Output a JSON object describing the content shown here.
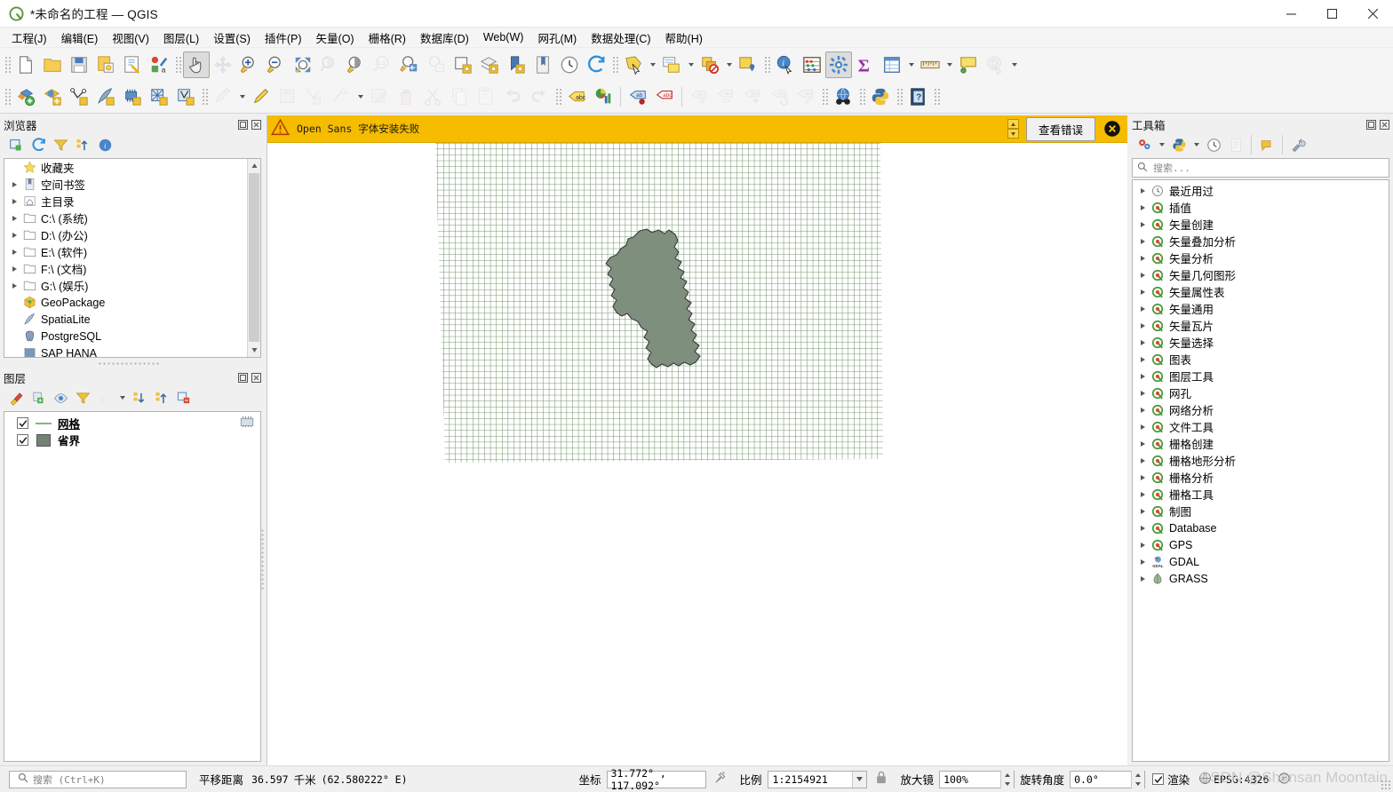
{
  "window": {
    "title": "*未命名的工程 — QGIS",
    "logo_icon": "qgis-logo-icon",
    "minimize_label": "—",
    "maximize_label": "□",
    "close_label": "✕"
  },
  "menubar": {
    "items": [
      {
        "label": "工程(J)",
        "mnemonic": "J"
      },
      {
        "label": "编辑(E)",
        "mnemonic": "E"
      },
      {
        "label": "视图(V)",
        "mnemonic": "V"
      },
      {
        "label": "图层(L)",
        "mnemonic": "L"
      },
      {
        "label": "设置(S)",
        "mnemonic": "S"
      },
      {
        "label": "插件(P)",
        "mnemonic": "P"
      },
      {
        "label": "矢量(O)",
        "mnemonic": "O"
      },
      {
        "label": "栅格(R)",
        "mnemonic": "R"
      },
      {
        "label": "数据库(D)",
        "mnemonic": "D"
      },
      {
        "label": "Web(W)",
        "mnemonic": "W"
      },
      {
        "label": "网孔(M)",
        "mnemonic": "M"
      },
      {
        "label": "数据处理(C)",
        "mnemonic": "C"
      },
      {
        "label": "帮助(H)",
        "mnemonic": "H"
      }
    ]
  },
  "toolbar_main": {
    "buttons": [
      {
        "name": "new-project-icon"
      },
      {
        "name": "open-project-icon"
      },
      {
        "name": "save-project-icon"
      },
      {
        "name": "save-project-as-icon"
      },
      {
        "name": "project-properties-icon"
      },
      {
        "name": "style-manager-icon"
      },
      {
        "name": "pan-map-icon",
        "active": true
      },
      {
        "name": "pan-to-selection-icon",
        "disabled": true
      },
      {
        "name": "zoom-in-icon"
      },
      {
        "name": "zoom-out-icon"
      },
      {
        "name": "zoom-full-icon"
      },
      {
        "name": "zoom-native-icon",
        "disabled": true
      },
      {
        "name": "zoom-to-selection-icon"
      },
      {
        "name": "zoom-1-1-icon",
        "disabled": true
      },
      {
        "name": "zoom-last-icon"
      },
      {
        "name": "zoom-next-icon",
        "disabled": true
      },
      {
        "name": "zoom-to-layer-icon"
      },
      {
        "name": "zoom-to-layers-icon"
      },
      {
        "name": "new-bookmark-icon"
      },
      {
        "name": "show-bookmarks-icon"
      },
      {
        "name": "temporal-controller-icon"
      },
      {
        "name": "refresh-icon"
      },
      {
        "name": "select-features-icon"
      },
      {
        "name": "attribute-table-icon"
      },
      {
        "name": "deselect-features-icon"
      },
      {
        "name": "select-value-icon"
      },
      {
        "name": "identify-features-icon"
      },
      {
        "name": "measure-abacus-icon"
      },
      {
        "name": "processing-toolbox-icon",
        "active": true
      },
      {
        "name": "statistical-summary-icon"
      },
      {
        "name": "open-table-icon"
      },
      {
        "name": "measure-line-icon"
      },
      {
        "name": "map-tips-icon"
      },
      {
        "name": "run-feature-action-icon",
        "disabled": true
      }
    ]
  },
  "toolbar_digitizing": {
    "buttons": [
      {
        "name": "add-layer-icon"
      },
      {
        "name": "add-wms-layer-icon"
      },
      {
        "name": "add-vector-layer-icon"
      },
      {
        "name": "add-spatialite-layer-icon"
      },
      {
        "name": "add-mesh-layer-icon"
      },
      {
        "name": "add-delimited-text-layer-icon"
      },
      {
        "name": "add-virtual-layer-icon"
      },
      {
        "name": "current-edits-icon",
        "disabled": true
      },
      {
        "name": "toggle-editing-icon"
      },
      {
        "name": "save-layer-edits-icon",
        "disabled": true
      },
      {
        "name": "add-feature-icon",
        "disabled": true
      },
      {
        "name": "vertex-tool-icon",
        "disabled": true
      },
      {
        "name": "modify-attributes-icon",
        "disabled": true
      },
      {
        "name": "delete-selected-icon",
        "disabled": true
      },
      {
        "name": "cut-features-icon",
        "disabled": true
      },
      {
        "name": "copy-features-icon",
        "disabled": true
      },
      {
        "name": "paste-features-icon",
        "disabled": true
      },
      {
        "name": "undo-icon",
        "disabled": true
      },
      {
        "name": "redo-icon",
        "disabled": true
      },
      {
        "name": "label-icon"
      },
      {
        "name": "diagram-icon"
      },
      {
        "name": "pin-labels-icon"
      },
      {
        "name": "highlight-labels-icon"
      },
      {
        "name": "move-label-icon",
        "disabled": true
      },
      {
        "name": "show-hide-labels-icon",
        "disabled": true
      },
      {
        "name": "move-label-diagram-icon",
        "disabled": true
      },
      {
        "name": "rotate-label-icon",
        "disabled": true
      },
      {
        "name": "change-label-icon",
        "disabled": true
      },
      {
        "name": "metasearch-icon"
      },
      {
        "name": "python-console-icon"
      },
      {
        "name": "help-icon"
      }
    ]
  },
  "browser_panel": {
    "title": "浏览器",
    "float_icon": "float-panel-icon",
    "close_icon": "close-panel-icon",
    "toolbar": [
      {
        "name": "add-layer-icon"
      },
      {
        "name": "refresh-icon"
      },
      {
        "name": "filter-browser-icon"
      },
      {
        "name": "collapse-all-icon"
      },
      {
        "name": "properties-info-icon"
      }
    ],
    "items": [
      {
        "label": "收藏夹",
        "icon": "favorites-star-icon",
        "expandable": false
      },
      {
        "label": "空间书签",
        "icon": "spatial-bookmarks-icon",
        "expandable": true
      },
      {
        "label": "主目录",
        "icon": "home-folder-icon",
        "expandable": true
      },
      {
        "label": "C:\\ (系统)",
        "icon": "folder-icon",
        "expandable": true
      },
      {
        "label": "D:\\ (办公)",
        "icon": "folder-icon",
        "expandable": true
      },
      {
        "label": "E:\\ (软件)",
        "icon": "folder-icon",
        "expandable": true
      },
      {
        "label": "F:\\ (文档)",
        "icon": "folder-icon",
        "expandable": true
      },
      {
        "label": "G:\\ (娱乐)",
        "icon": "folder-icon",
        "expandable": true
      },
      {
        "label": "GeoPackage",
        "icon": "geopackage-icon",
        "expandable": false
      },
      {
        "label": "SpatiaLite",
        "icon": "spatialite-icon",
        "expandable": false
      },
      {
        "label": "PostgreSQL",
        "icon": "postgresql-icon",
        "expandable": false
      },
      {
        "label": "SAP HANA",
        "icon": "sap-hana-icon",
        "expandable": false
      }
    ]
  },
  "layers_panel": {
    "title": "图层",
    "float_icon": "float-panel-icon",
    "close_icon": "close-panel-icon",
    "toolbar": [
      {
        "name": "open-layer-styling-icon"
      },
      {
        "name": "add-group-icon"
      },
      {
        "name": "manage-layer-visibility-icon"
      },
      {
        "name": "filter-legend-icon"
      },
      {
        "name": "filter-legend-expression-icon",
        "disabled": true
      },
      {
        "name": "expand-all-icon"
      },
      {
        "name": "collapse-all-icon"
      },
      {
        "name": "remove-layer-icon"
      }
    ],
    "layers": [
      {
        "label": "网格",
        "checked": true,
        "symbol": "line-symbol",
        "symbol_color": "#8fae8b",
        "bold": true,
        "underline": true,
        "indicator": "mesh-indicator-icon"
      },
      {
        "label": "省界",
        "checked": true,
        "symbol": "polygon-symbol",
        "symbol_color": "#738273",
        "bold": true,
        "underline": false
      }
    ]
  },
  "message_bar": {
    "icon": "warning-triangle-icon",
    "text": "Open Sans 字体安装失败",
    "button_label": "查看错误",
    "close_icon": "close-icon"
  },
  "toolbox_panel": {
    "title": "工具箱",
    "float_icon": "float-panel-icon",
    "close_icon": "close-panel-icon",
    "toolbar": [
      {
        "name": "processing-models-icon"
      },
      {
        "name": "python-scripts-icon"
      },
      {
        "name": "history-icon"
      },
      {
        "name": "results-viewer-icon",
        "disabled": true
      },
      {
        "name": "edit-model-icon"
      },
      {
        "name": "options-wrench-icon"
      }
    ],
    "search": {
      "placeholder": "搜索...",
      "icon": "search-icon",
      "value": ""
    },
    "groups": [
      {
        "label": "最近用过",
        "icon": "history-clock-icon"
      },
      {
        "label": "插值",
        "icon": "qgis-algorithm-icon"
      },
      {
        "label": "矢量创建",
        "icon": "qgis-algorithm-icon"
      },
      {
        "label": "矢量叠加分析",
        "icon": "qgis-algorithm-icon"
      },
      {
        "label": "矢量分析",
        "icon": "qgis-algorithm-icon"
      },
      {
        "label": "矢量几何图形",
        "icon": "qgis-algorithm-icon"
      },
      {
        "label": "矢量属性表",
        "icon": "qgis-algorithm-icon"
      },
      {
        "label": "矢量通用",
        "icon": "qgis-algorithm-icon"
      },
      {
        "label": "矢量瓦片",
        "icon": "qgis-algorithm-icon"
      },
      {
        "label": "矢量选择",
        "icon": "qgis-algorithm-icon"
      },
      {
        "label": "图表",
        "icon": "qgis-algorithm-icon"
      },
      {
        "label": "图层工具",
        "icon": "qgis-algorithm-icon"
      },
      {
        "label": "网孔",
        "icon": "qgis-algorithm-icon"
      },
      {
        "label": "网络分析",
        "icon": "qgis-algorithm-icon"
      },
      {
        "label": "文件工具",
        "icon": "qgis-algorithm-icon"
      },
      {
        "label": "栅格创建",
        "icon": "qgis-algorithm-icon"
      },
      {
        "label": "栅格地形分析",
        "icon": "qgis-algorithm-icon"
      },
      {
        "label": "栅格分析",
        "icon": "qgis-algorithm-icon"
      },
      {
        "label": "栅格工具",
        "icon": "qgis-algorithm-icon"
      },
      {
        "label": "制图",
        "icon": "qgis-algorithm-icon"
      },
      {
        "label": "Database",
        "icon": "qgis-algorithm-icon"
      },
      {
        "label": "GPS",
        "icon": "qgis-algorithm-icon"
      },
      {
        "label": "GDAL",
        "icon": "gdal-icon"
      },
      {
        "label": "GRASS",
        "icon": "grass-icon"
      }
    ]
  },
  "status_bar": {
    "search_placeholder": "搜索 (Ctrl+K)",
    "search_icon": "search-icon",
    "pan_distance_label": "平移距离",
    "pan_distance_value": "36.597",
    "pan_distance_unit": "千米",
    "pan_distance_extra": "(62.580222° E)",
    "coordinate_label": "坐标",
    "coordinate_value": "31.772° , 117.092°",
    "coordinate_toggle_icon": "toggle-extents-icon",
    "scale_label": "比例",
    "scale_value": "1:2154921",
    "scale_dropdown_icon": "chevron-down-icon",
    "lock_icon": "lock-scale-icon",
    "magnifier_label": "放大镜",
    "magnifier_value": "100%",
    "rotation_label": "旋转角度",
    "rotation_value": "0.0°",
    "render_checkbox_label": "渲染",
    "render_checked": true,
    "crs_label": "EPSG:4326",
    "crs_icon": "crs-globe-icon",
    "messages_icon": "messages-icon",
    "watermark": "CSDN @Shansan Moontain"
  },
  "map": {
    "grid_layer_color": "#6f9468",
    "province_fill": "#7e8f7e",
    "province_stroke": "#3b3b3b",
    "background": "#ffffff"
  }
}
